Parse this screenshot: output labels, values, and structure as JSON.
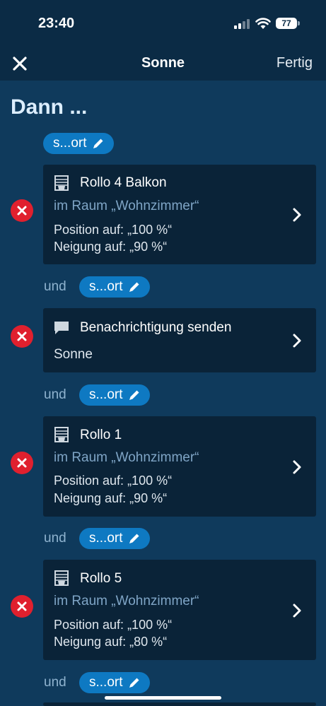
{
  "status": {
    "time": "23:40",
    "battery": "77"
  },
  "header": {
    "title": "Sonne",
    "done": "Fertig"
  },
  "section_title": "Dann ...",
  "chip_label": "s...ort",
  "connector": "und",
  "actions": [
    {
      "title": "Rollo 4 Balkon",
      "room": "im Raum „Wohnzimmer“",
      "position": "Position auf: „100 %“",
      "tilt": "Neigung auf: „90 %“"
    },
    {
      "title": "Benachrichtigung senden",
      "message": "Sonne"
    },
    {
      "title": "Rollo 1",
      "room": "im Raum „Wohnzimmer“",
      "position": "Position auf: „100 %“",
      "tilt": "Neigung auf: „90 %“"
    },
    {
      "title": "Rollo 5",
      "room": "im Raum „Wohnzimmer“",
      "position": "Position auf: „100 %“",
      "tilt": "Neigung auf: „80 %“"
    }
  ],
  "colors": {
    "background": "#0f3a5c",
    "card": "#0a2338",
    "chip": "#0e79c2",
    "delete": "#e0202e",
    "room_text": "#7fa5c6"
  }
}
